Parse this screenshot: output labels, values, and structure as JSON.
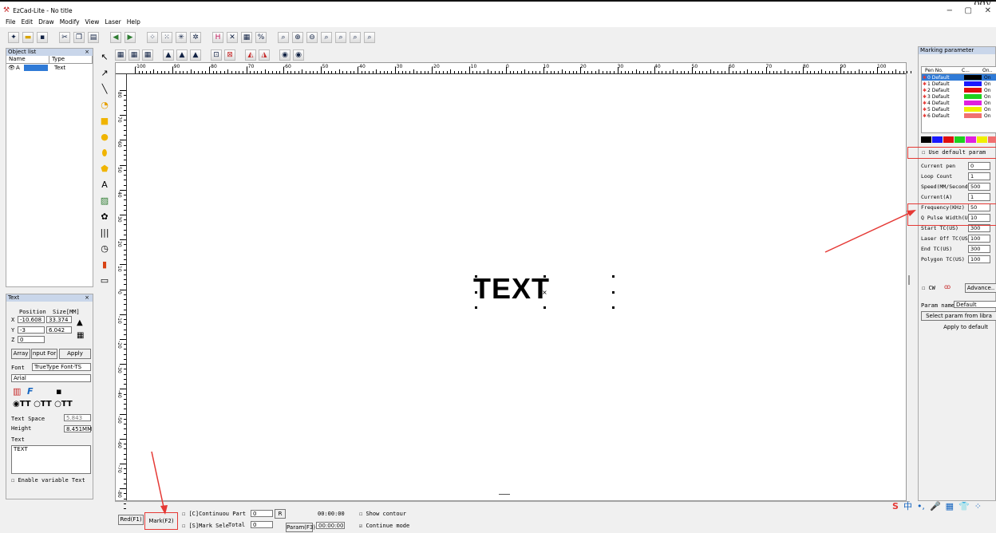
{
  "window": {
    "title": "EzCad-Lite - No title",
    "watermark": "ogy",
    "min": "−",
    "restore": "▢",
    "close": "✕"
  },
  "menu": [
    "File",
    "Edit",
    "Draw",
    "Modify",
    "View",
    "Laser",
    "Help"
  ],
  "object_list": {
    "title": "Object list",
    "close": "×",
    "columns": [
      "Name",
      "Type"
    ],
    "rows": [
      {
        "name": "A",
        "type": "Text"
      }
    ]
  },
  "ruler": {
    "h_labels": [
      "-100",
      "-90",
      "-80",
      "-70",
      "-60",
      "-50",
      "-40",
      "-30",
      "-20",
      "-10",
      "0",
      "10",
      "20",
      "30",
      "40",
      "50",
      "60",
      "70",
      "80",
      "90",
      "100"
    ],
    "v_labels": [
      "80",
      "70",
      "60",
      "50",
      "40",
      "30",
      "20",
      "10",
      "0",
      "-10",
      "-20",
      "-30",
      "-40",
      "-50",
      "-60",
      "-70",
      "-80"
    ]
  },
  "canvas": {
    "text": "TEXT"
  },
  "text_panel": {
    "title": "Text",
    "close": "×",
    "pos_label": "Position",
    "size_label": "Size[MM]",
    "x_label": "X",
    "y_label": "Y",
    "z_label": "Z",
    "x": "-10.608",
    "y": "-3",
    "z": "0",
    "size_x": "33.374",
    "size_y": "6.042",
    "array_btn": "Array",
    "input_btn": "nput For",
    "apply_btn": "Apply",
    "font_label": "Font",
    "font_type": "TrueType Font-TS",
    "font_name": "Arial",
    "text_space_label": "Text Space",
    "text_space": "5.843",
    "height_label": "Height",
    "height": "8.451MM",
    "text_label": "Text",
    "text_value": "TEXT",
    "enable_variable": "Enable variable Text"
  },
  "bottom": {
    "red_btn": "Red(F1)",
    "mark_btn": "Mark(F2)",
    "continuous_part": "[C]Continuou Part",
    "mark_select": "[S]Mark Sele",
    "part_value": "0",
    "total_label": "Total",
    "total_value": "0",
    "r_btn": "R",
    "param_btn": "Param(F3)",
    "time1": "00:00:00",
    "time2": "00:00:00",
    "show_contour": "Show contour",
    "continue_mode": "Continue mode"
  },
  "marking": {
    "title": "Marking parameter",
    "pen_header": [
      "Pen No.",
      "C...",
      "On.."
    ],
    "pens": [
      {
        "label": "0 Default",
        "color": "#000000",
        "on": "On"
      },
      {
        "label": "1 Default",
        "color": "#1a1aff",
        "on": "On"
      },
      {
        "label": "2 Default",
        "color": "#e01010",
        "on": "On"
      },
      {
        "label": "3 Default",
        "color": "#1ed11e",
        "on": "On"
      },
      {
        "label": "4 Default",
        "color": "#e020e0",
        "on": "On"
      },
      {
        "label": "5 Default",
        "color": "#f0f000",
        "on": "On"
      },
      {
        "label": "6 Default",
        "color": "#f07070",
        "on": "On"
      }
    ],
    "palette": [
      "#000000",
      "#1a1aff",
      "#e01010",
      "#1ed11e",
      "#e020e0",
      "#f0f000",
      "#f07070"
    ],
    "use_default": "Use default param",
    "params": [
      {
        "label": "Current pen",
        "value": "0"
      },
      {
        "label": "Loop Count",
        "value": "1"
      },
      {
        "label": "Speed(MM/Second",
        "value": "500"
      },
      {
        "label": "Current(A)",
        "value": "1"
      },
      {
        "label": "Frequency(KHz)",
        "value": "50"
      },
      {
        "label": "Q Pulse Width(U",
        "value": "10"
      },
      {
        "label": "Start TC(US)",
        "value": "300"
      },
      {
        "label": "Laser Off TC(US",
        "value": "100"
      },
      {
        "label": "End TC(US)",
        "value": "300"
      },
      {
        "label": "Polygon TC(US)",
        "value": "100"
      }
    ],
    "cw": "CW",
    "advance": "Advance..",
    "param_name_label": "Param name",
    "param_name": "Default",
    "select_param": "Select param from libra",
    "apply_default": "Apply to default"
  },
  "accent": "#e53935"
}
